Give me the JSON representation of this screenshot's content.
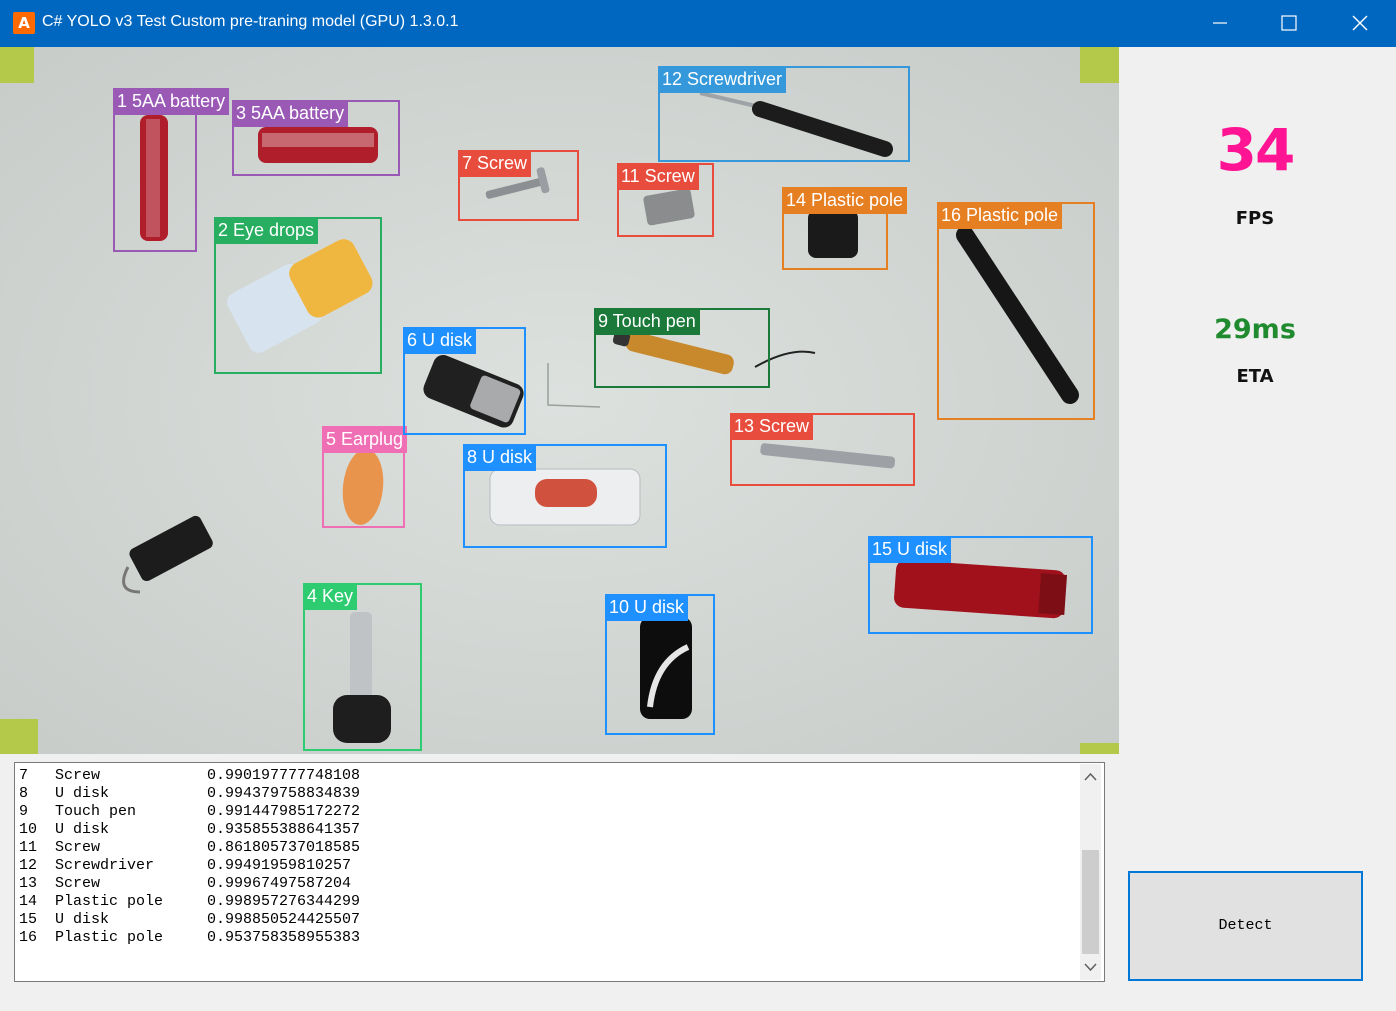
{
  "window": {
    "title": "C# YOLO v3 Test Custom pre-traning model (GPU) 1.3.0.1",
    "app_icon": "A"
  },
  "stats": {
    "fps_value": "34",
    "fps_label": "FPS",
    "eta_value": "29ms",
    "eta_label": "ETA"
  },
  "detections": [
    {
      "label": "1 5AA battery",
      "color": "#9b59b6"
    },
    {
      "label": "2 Eye drops",
      "color": "#27ae60"
    },
    {
      "label": "3 5AA battery",
      "color": "#9b59b6"
    },
    {
      "label": "4 Key",
      "color": "#2ecc71"
    },
    {
      "label": "5 Earplug",
      "color": "#f06eb4"
    },
    {
      "label": "6 U disk",
      "color": "#1e90ff"
    },
    {
      "label": "7 Screw",
      "color": "#e74c3c"
    },
    {
      "label": "8 U disk",
      "color": "#1e90ff"
    },
    {
      "label": "9 Touch pen",
      "color": "#1b7a3a"
    },
    {
      "label": "10 U disk",
      "color": "#1e90ff"
    },
    {
      "label": "11 Screw",
      "color": "#e74c3c"
    },
    {
      "label": "12 Screwdriver",
      "color": "#3498db"
    },
    {
      "label": "13 Screw",
      "color": "#e74c3c"
    },
    {
      "label": "14 Plastic pole",
      "color": "#e67e22"
    },
    {
      "label": "15 U disk",
      "color": "#1e90ff"
    },
    {
      "label": "16 Plastic pole",
      "color": "#e67e22"
    }
  ],
  "results": [
    {
      "id": "7",
      "name": "Screw",
      "score": "0.990197777748108"
    },
    {
      "id": "8",
      "name": "U disk",
      "score": "0.994379758834839"
    },
    {
      "id": "9",
      "name": "Touch pen",
      "score": "0.991447985172272"
    },
    {
      "id": "10",
      "name": "U disk",
      "score": "0.935855388641357"
    },
    {
      "id": "11",
      "name": "Screw",
      "score": "0.861805737018585"
    },
    {
      "id": "12",
      "name": "Screwdriver",
      "score": "0.99491959810257"
    },
    {
      "id": "13",
      "name": "Screw",
      "score": "0.99967497587204"
    },
    {
      "id": "14",
      "name": "Plastic pole",
      "score": "0.998957276344299"
    },
    {
      "id": "15",
      "name": "U disk",
      "score": "0.998850524425507"
    },
    {
      "id": "16",
      "name": "Plastic pole",
      "score": "0.953758358955383"
    }
  ],
  "detect_button": {
    "label": "Detect"
  }
}
